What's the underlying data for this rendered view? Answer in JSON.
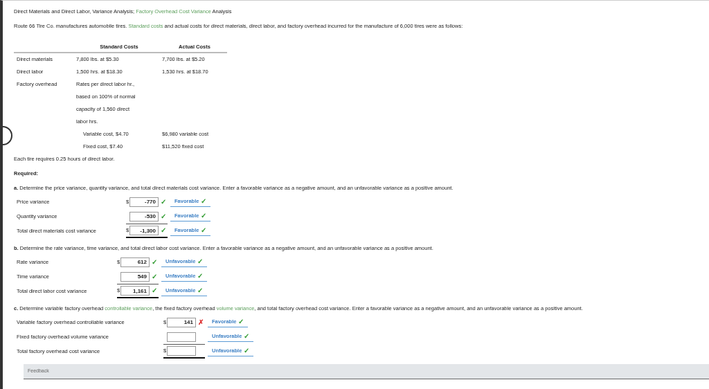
{
  "title": [
    {
      "kind": "plain",
      "text": "Direct Materials and Direct Labor, Variance Analysis; "
    },
    {
      "kind": "link",
      "text": "Factory Overhead Cost Variance"
    },
    {
      "kind": "plain",
      "text": " Analysis"
    }
  ],
  "intro": [
    {
      "kind": "plain",
      "text": "Route 66 Tire Co. manufactures automobile tires. "
    },
    {
      "kind": "link",
      "text": "Standard costs"
    },
    {
      "kind": "plain",
      "text": " and actual costs for direct materials, direct labor, and factory overhead incurred for the manufacture of 6,000 tires were as follows:"
    }
  ],
  "cost_table": {
    "columns": [
      "Standard Costs",
      "Actual Costs"
    ],
    "rows": [
      {
        "label": "Direct materials",
        "standard": "7,800 lbs. at $5.30",
        "actual": "7,700 lbs. at $5.20",
        "indent": false
      },
      {
        "label": "Direct labor",
        "standard": "1,500 hrs. at $18.30",
        "actual": "1,530 hrs. at $18.70",
        "indent": false
      },
      {
        "label": "Factory overhead",
        "standard": "Rates per direct labor hr.,",
        "actual": "",
        "indent": false
      },
      {
        "label": "",
        "standard": "based on 100% of normal",
        "actual": "",
        "indent": false
      },
      {
        "label": "",
        "standard": "capacity of 1,560 direct",
        "actual": "",
        "indent": false
      },
      {
        "label": "",
        "standard": "labor hrs.",
        "actual": "",
        "indent": false
      },
      {
        "label": "",
        "standard": "Variable cost, $4.70",
        "actual": "$6,980 variable cost",
        "indent": true
      },
      {
        "label": "",
        "standard": "Fixed cost, $7.40",
        "actual": "$11,520 fixed cost",
        "indent": true
      }
    ]
  },
  "note": "Each tire requires 0.25 hours of direct labor.",
  "required": "Required:",
  "sections": [
    {
      "prompt": [
        {
          "kind": "plain",
          "text": "**a.** Determine the price variance, quantity variance, and total direct materials cost variance. Enter a favorable variance as a negative amount, and an unfavorable variance as a positive amount."
        }
      ],
      "rows": [
        {
          "label": "Price variance",
          "dollar": "$",
          "value": "-770",
          "mark": "✓",
          "correct": true,
          "choice": "Favorable",
          "choice_mark": "✓",
          "total": false
        },
        {
          "label": "Quantity variance",
          "dollar": "",
          "value": "-530",
          "mark": "✓",
          "correct": true,
          "choice": "Favorable",
          "choice_mark": "✓",
          "total": false
        },
        {
          "label": "Total direct materials cost variance",
          "dollar": "$",
          "value": "-1,300",
          "mark": "✓",
          "correct": true,
          "choice": "Favorable",
          "choice_mark": "✓",
          "total": true
        }
      ]
    },
    {
      "prompt": [
        {
          "kind": "plain",
          "text": "**b.** Determine the rate variance, time variance, and total direct labor cost variance. Enter a favorable variance as a negative amount, and an unfavorable variance as a positive amount."
        }
      ],
      "rows": [
        {
          "label": "Rate variance",
          "dollar": "$",
          "value": "612",
          "mark": "✓",
          "correct": true,
          "choice": "Unfavorable",
          "choice_mark": "✓",
          "total": false
        },
        {
          "label": "Time variance",
          "dollar": "",
          "value": "549",
          "mark": "✓",
          "correct": true,
          "choice": "Unfavorable",
          "choice_mark": "✓",
          "total": false
        },
        {
          "label": "Total direct labor cost variance",
          "dollar": "$",
          "value": "1,161",
          "mark": "✓",
          "correct": true,
          "choice": "Unfavorable",
          "choice_mark": "✓",
          "total": true
        }
      ]
    },
    {
      "prompt": [
        {
          "kind": "plain",
          "text": "**c.** Determine variable factory overhead "
        },
        {
          "kind": "link",
          "text": "controllable variance"
        },
        {
          "kind": "plain",
          "text": ", the fixed factory overhead "
        },
        {
          "kind": "link",
          "text": "volume variance"
        },
        {
          "kind": "plain",
          "text": ", and total factory overhead cost variance. Enter a favorable variance as a negative amount, and an unfavorable variance as a positive amount."
        }
      ],
      "rows": [
        {
          "label": "Variable factory overhead controllable variance",
          "dollar": "$",
          "value": "141",
          "mark": "✗",
          "correct": false,
          "choice": "Favorable",
          "choice_mark": "✓",
          "total": false
        },
        {
          "label": "Fixed factory overhead volume variance",
          "dollar": "",
          "value": "",
          "choice": "Unfavorable",
          "choice_mark": "✓",
          "total": false
        },
        {
          "label": "Total factory overhead cost variance",
          "dollar": "$",
          "value": "",
          "choice": "Unfavorable",
          "choice_mark": "✓",
          "total": true
        }
      ]
    }
  ],
  "feedback": "Feedback"
}
